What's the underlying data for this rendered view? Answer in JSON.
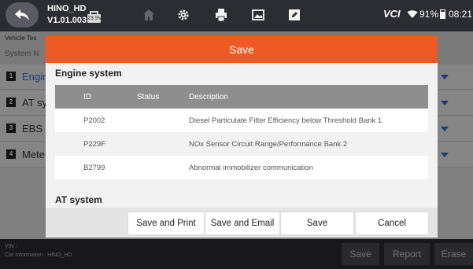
{
  "status_bar": {
    "app_name": "HINO_HD",
    "version": "V1.01.003",
    "voltage": "23.9V",
    "vci_label": "VCI",
    "battery": "91%",
    "clock": "08:21"
  },
  "page": {
    "breadcrumb": "Vehicle Tes",
    "system_name_label": "System N",
    "rows": [
      {
        "num": "1",
        "label": "Engin"
      },
      {
        "num": "2",
        "label": "AT sy"
      },
      {
        "num": "3",
        "label": "EBS E"
      },
      {
        "num": "4",
        "label": "Mete"
      }
    ]
  },
  "bottom_bar": {
    "vin_label": "VIN :",
    "car_info": "Car Information : HINO_HD",
    "save": "Save",
    "report": "Report",
    "erase": "Erase"
  },
  "modal": {
    "title": "Save",
    "section1_title": "Engine system",
    "section2_title": "AT system",
    "columns": {
      "id": "ID",
      "status": "Status",
      "description": "Description"
    },
    "rows": [
      {
        "id": "P2002",
        "status": "",
        "description": "Diesel Particulate Filter Efficiency below Threshold Bank 1"
      },
      {
        "id": "P229F",
        "status": "",
        "description": "NOx Sensor Circuit Range/Performance Bank 2"
      },
      {
        "id": "B2799",
        "status": "",
        "description": "Abnormal immobilizer communication"
      }
    ],
    "buttons": {
      "save_print": "Save and Print",
      "save_email": "Save and Email",
      "save": "Save",
      "cancel": "Cancel"
    }
  },
  "colors": {
    "accent": "#ee5a23",
    "topbar": "#2c2c33",
    "table_header": "#8e8e8e",
    "link_blue": "#2d6fd4"
  }
}
